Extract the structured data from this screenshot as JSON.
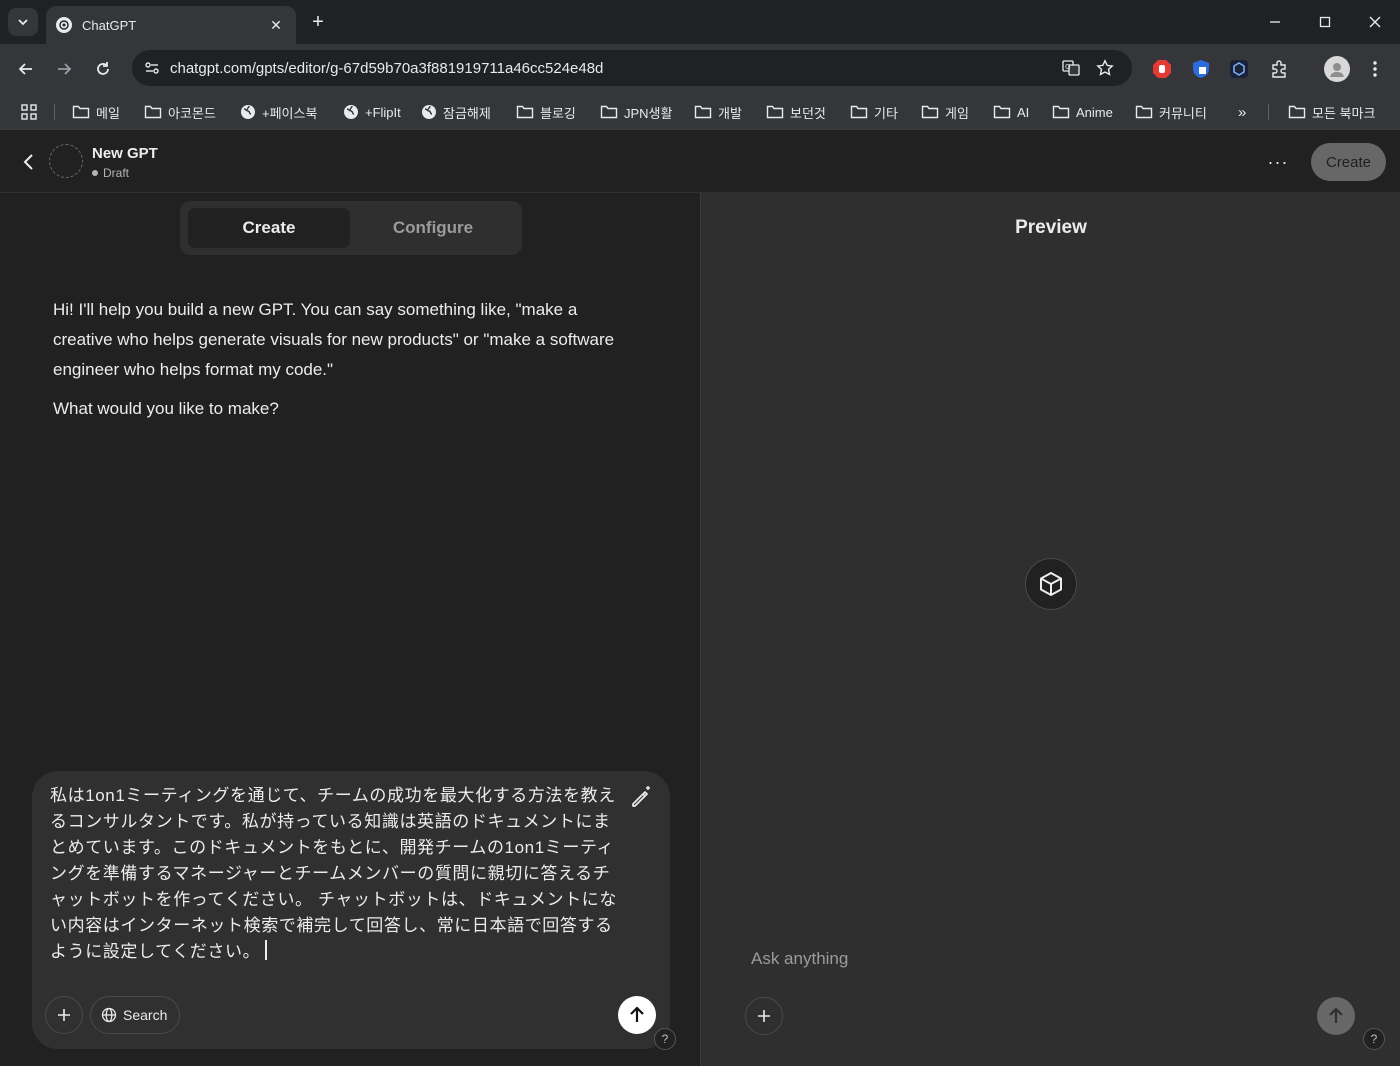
{
  "browser": {
    "tab": {
      "title": "ChatGPT"
    },
    "url": "chatgpt.com/gpts/editor/g-67d59b70a3f881919711a46cc524e48d",
    "bookmarks": [
      {
        "label": "메일",
        "kind": "folder"
      },
      {
        "label": "아코몬드",
        "kind": "folder"
      },
      {
        "label": "+페이스북",
        "kind": "globe"
      },
      {
        "label": "+FlipIt",
        "kind": "globe"
      },
      {
        "label": "잠금해제",
        "kind": "globe"
      },
      {
        "label": "블로깅",
        "kind": "folder"
      },
      {
        "label": "JPN생활",
        "kind": "folder"
      },
      {
        "label": "개발",
        "kind": "folder"
      },
      {
        "label": "보던것",
        "kind": "folder"
      },
      {
        "label": "기타",
        "kind": "folder"
      },
      {
        "label": "게임",
        "kind": "folder"
      },
      {
        "label": "AI",
        "kind": "folder"
      },
      {
        "label": "Anime",
        "kind": "folder"
      },
      {
        "label": "커뮤니티",
        "kind": "folder"
      }
    ],
    "overflow_label": "»",
    "all_bookmarks_label": "모든 북마크"
  },
  "header": {
    "gpt_name": "New GPT",
    "status": "Draft",
    "more_label": "···",
    "create_label": "Create"
  },
  "editor": {
    "tabs": {
      "create": "Create",
      "configure": "Configure"
    },
    "message_paragraphs": [
      "Hi! I'll help you build a new GPT. You can say something like, \"make a creative who helps generate visuals for new products\" or \"make a software engineer who helps format my code.\"",
      "What would you like to make?"
    ],
    "composer_text": "私は1on1ミーティングを通じて、チームの成功を最大化する方法を教えるコンサルタントです。私が持っている知識は英語のドキュメントにまとめています。このドキュメントをもとに、開発チームの1on1ミーティングを準備するマネージャーとチームメンバーの質問に親切に答えるチャットボットを作ってください。 チャットボットは、ドキュメントにない内容はインターネット検索で補完して回答し、常に日本語で回答するように設定してください。",
    "search_label": "Search",
    "help_label": "?"
  },
  "preview": {
    "title": "Preview",
    "placeholder": "Ask anything",
    "help_label": "?"
  },
  "colors": {
    "page_bg": "#212121",
    "preview_bg": "#2f2f2f",
    "chrome_bg": "#35363a",
    "text": "#ececec",
    "muted": "#9b9b9b"
  }
}
